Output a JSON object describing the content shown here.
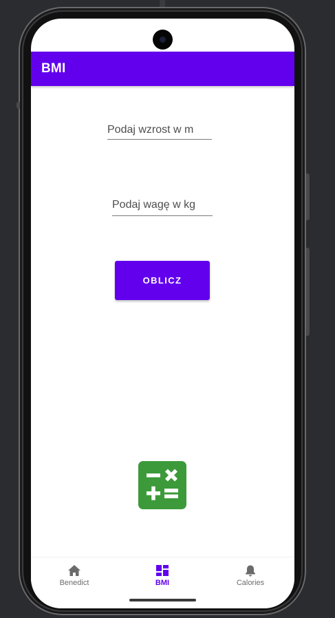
{
  "app_bar": {
    "title": "BMI",
    "color": "#6200ee"
  },
  "form": {
    "height_placeholder": "Podaj wzrost w m",
    "weight_placeholder": "Podaj wagę w kg",
    "calculate_label": "OBLICZ"
  },
  "illustration": {
    "icon": "calculator-icon",
    "color": "#3c9a3a"
  },
  "bottom_nav": {
    "items": [
      {
        "label": "Benedict",
        "icon": "home-icon",
        "active": false
      },
      {
        "label": "BMI",
        "icon": "dashboard-icon",
        "active": true
      },
      {
        "label": "Calories",
        "icon": "bell-icon",
        "active": false
      }
    ],
    "active_color": "#6200ee"
  }
}
